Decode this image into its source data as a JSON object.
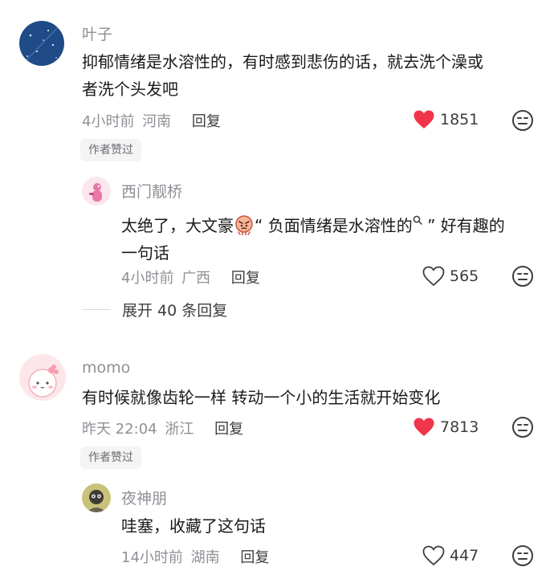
{
  "comments": [
    {
      "username": "叶子",
      "content_line1": "抑郁情绪是水溶性的，有时感到悲伤的话，就去洗个澡或",
      "content_line2": "者洗个头发吧",
      "time": "4小时前",
      "location": "河南",
      "reply_label": "回复",
      "like_count": "1851",
      "liked": true,
      "badge": "作者赞过",
      "replies": [
        {
          "username": "西门靓桥",
          "content_part1": "太绝了，大文豪",
          "content_part2": "“ 负面情绪是水溶性的",
          "content_part3": " ” 好有趣的",
          "content_line2": "一句话",
          "time": "4小时前",
          "location": "广西",
          "reply_label": "回复",
          "like_count": "565",
          "liked": false
        }
      ],
      "expand_label": "展开 40 条回复"
    },
    {
      "username": "momo",
      "content_line1": "有时候就像齿轮一样 转动一个小的生活就开始变化",
      "time": "昨天 22:04",
      "location": "浙江",
      "reply_label": "回复",
      "like_count": "7813",
      "liked": true,
      "badge": "作者赞过",
      "replies": [
        {
          "username": "夜神朋",
          "content_line1": "哇塞，收藏了这句话",
          "time": "14小时前",
          "location": "湖南",
          "reply_label": "回复",
          "like_count": "447",
          "liked": false
        }
      ]
    }
  ],
  "colors": {
    "like_active": "#f0354b",
    "text_primary": "#1a1a1a",
    "text_secondary": "#8f9096"
  },
  "icons": {
    "like": "heart-icon",
    "dislike": "neutral-face-icon",
    "keyword_search": "search-icon"
  }
}
